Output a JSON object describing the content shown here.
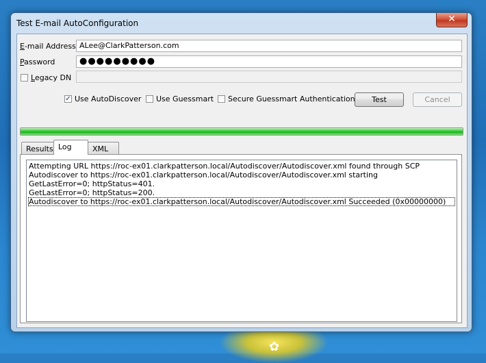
{
  "window": {
    "title": "Test E-mail AutoConfiguration",
    "close_glyph": "✕"
  },
  "form": {
    "email_label": "E-mail Address",
    "email_value": "ALee@ClarkPatterson.com",
    "password_label": "Password",
    "password_mask": "●●●●●●●●●",
    "legacy_dn_label": "Legacy DN",
    "legacy_dn_checked": false,
    "legacy_dn_value": ""
  },
  "options": {
    "use_autodiscover_label": "Use AutoDiscover",
    "use_autodiscover_checked": true,
    "use_guessmart_label": "Use Guessmart",
    "use_guessmart_checked": false,
    "secure_guessmart_label": "Secure Guessmart Authentication",
    "secure_guessmart_checked": false,
    "check_glyph": "✓"
  },
  "buttons": {
    "test_label": "Test",
    "cancel_label": "Cancel"
  },
  "progress": {
    "value_fraction": 1.0,
    "color": "#1db51d"
  },
  "tabs": [
    {
      "label": "Results",
      "active": false
    },
    {
      "label": "Log",
      "active": true
    },
    {
      "label": "XML",
      "active": false
    }
  ],
  "log": {
    "lines": [
      "Attempting URL https://roc-ex01.clarkpatterson.local/Autodiscover/Autodiscover.xml found through SCP",
      "Autodiscover to https://roc-ex01.clarkpatterson.local/Autodiscover/Autodiscover.xml starting",
      "GetLastError=0; httpStatus=401.",
      "GetLastError=0; httpStatus=200.",
      "Autodiscover to https://roc-ex01.clarkpatterson.local/Autodiscover/Autodiscover.xml Succeeded (0x00000000)"
    ],
    "selected_index": 4
  }
}
